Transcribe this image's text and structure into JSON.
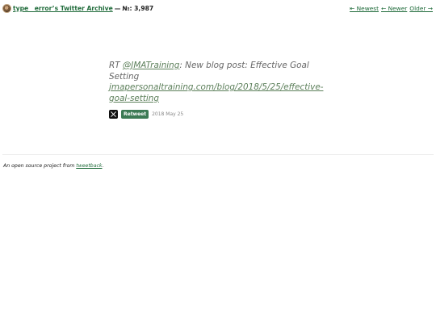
{
  "header": {
    "archive_link": "type__error’s Twitter Archive",
    "separator": "—",
    "count": "№: 3,987"
  },
  "pager": {
    "newest": "⇤ Newest",
    "newer": "← Newer",
    "older": "Older →"
  },
  "tweet": {
    "prefix": "RT ",
    "mention": "@JMATraining",
    "body": ": New blog post: Effective Goal Setting ",
    "url": "jmapersonaltraining.com/blog/2018/5/25/effective-goal-setting",
    "badge": "Retweet",
    "date": "2018 May 25",
    "source_icon": "x-logo-icon"
  },
  "footer": {
    "prefix": "An open source project from ",
    "link": "tweetback",
    "suffix": "."
  },
  "colors": {
    "link": "#1f6b3a",
    "badge": "#3c7a54"
  }
}
